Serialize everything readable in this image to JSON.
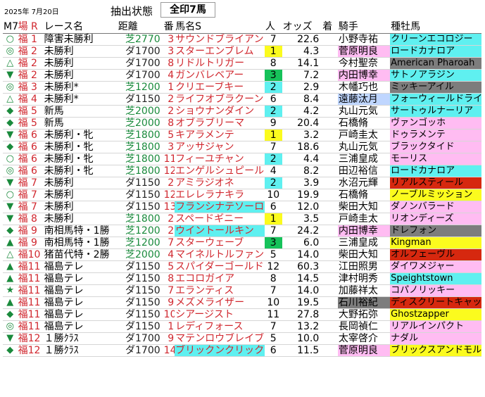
{
  "header": {
    "date": "2025年 7月20日",
    "state_label": "抽出状態",
    "state_value": "全印7馬"
  },
  "columns": [
    "M7",
    "場 R",
    "レース名",
    "距離",
    "番",
    "馬名S",
    "人",
    "オッズ",
    "着",
    "騎手",
    "種牡馬"
  ],
  "colors": {
    "cyan": "#5ff0f0",
    "yellow": "#fbfb1e",
    "green": "#16c25a",
    "pink": "#ffbcf2",
    "lightblue": "#bfd6ff",
    "gray": "#7d7d7d",
    "red": "#d6280f",
    "turf": "#1a8a3c",
    "place": "#d0272e"
  },
  "rows": [
    {
      "mark": "○",
      "place": "福 1",
      "race": "障害未勝利",
      "dist": "芝2770",
      "surf": "turf",
      "num": "3",
      "horse": "サウンドブライアン",
      "horse_hl": "",
      "pop": "7",
      "pop_hl": "",
      "odds": "22.6",
      "jockey": "小野寺祐",
      "jockey_hl": "",
      "sire": "クリーンエコロジー",
      "sire_hl": "cyan"
    },
    {
      "mark": "◎",
      "place": "福 2",
      "race": "未勝利",
      "dist": "ダ1700",
      "surf": "dirt",
      "num": "3",
      "horse": "スターエンブレム",
      "horse_hl": "",
      "pop": "1",
      "pop_hl": "yellow",
      "odds": "4.3",
      "jockey": "菅原明良",
      "jockey_hl": "pink",
      "sire": "ロードカナロア",
      "sire_hl": "cyan"
    },
    {
      "mark": "△",
      "place": "福 2",
      "race": "未勝利",
      "dist": "ダ1700",
      "surf": "dirt",
      "num": "8",
      "horse": "リドルトリガー",
      "horse_hl": "",
      "pop": "8",
      "pop_hl": "",
      "odds": "14.1",
      "jockey": "今村聖奈",
      "jockey_hl": "",
      "sire": "American Pharoah",
      "sire_hl": "gray"
    },
    {
      "mark": "▼",
      "place": "福 2",
      "race": "未勝利",
      "dist": "ダ1700",
      "surf": "dirt",
      "num": "4",
      "horse": "ガンバレベアー",
      "horse_hl": "",
      "pop": "3",
      "pop_hl": "green",
      "odds": "7.2",
      "jockey": "内田博幸",
      "jockey_hl": "pink",
      "sire": "サトノアラジン",
      "sire_hl": "cyan"
    },
    {
      "mark": "◎",
      "place": "福 3",
      "race": "未勝利*",
      "dist": "芝1200",
      "surf": "turf",
      "num": "1",
      "horse": "クリエーブキー",
      "horse_hl": "",
      "pop": "2",
      "pop_hl": "cyan",
      "odds": "2.9",
      "jockey": "木幡巧也",
      "jockey_hl": "",
      "sire": "ミッキーアイル",
      "sire_hl": "gray"
    },
    {
      "mark": "△",
      "place": "福 4",
      "race": "未勝利*",
      "dist": "ダ1150",
      "surf": "dirt",
      "num": "2",
      "horse": "ライフオブラクーン",
      "horse_hl": "",
      "pop": "6",
      "pop_hl": "",
      "odds": "8.4",
      "jockey": "遠藤汰月",
      "jockey_hl": "lightblue",
      "sire": "フォーウィールドライブ",
      "sire_hl": "cyan"
    },
    {
      "mark": "◆",
      "place": "福 5",
      "race": "新馬",
      "dist": "芝2000",
      "surf": "turf",
      "num": "2",
      "horse": "ショウナンダイン",
      "horse_hl": "",
      "pop": "2",
      "pop_hl": "cyan",
      "odds": "4.2",
      "jockey": "丸山元気",
      "jockey_hl": "",
      "sire": "サートゥルナーリア",
      "sire_hl": "cyan"
    },
    {
      "mark": "◆",
      "place": "福 5",
      "race": "新馬",
      "dist": "芝2000",
      "surf": "turf",
      "num": "8",
      "horse": "オブラブリーマ",
      "horse_hl": "",
      "pop": "9",
      "pop_hl": "",
      "odds": "20.4",
      "jockey": "石橋脩",
      "jockey_hl": "",
      "sire": "ヴァンゴッホ",
      "sire_hl": "pink"
    },
    {
      "mark": "▼",
      "place": "福 6",
      "race": "未勝利・牝",
      "dist": "芝1800",
      "surf": "turf",
      "num": "5",
      "horse": "キアラメンテ",
      "horse_hl": "",
      "pop": "1",
      "pop_hl": "yellow",
      "odds": "3.2",
      "jockey": "戸崎圭太",
      "jockey_hl": "",
      "sire": "ドゥラメンテ",
      "sire_hl": "pink"
    },
    {
      "mark": "◆",
      "place": "福 6",
      "race": "未勝利・牝",
      "dist": "芝1800",
      "surf": "turf",
      "num": "3",
      "horse": "アッサジャン",
      "horse_hl": "",
      "pop": "7",
      "pop_hl": "",
      "odds": "18.6",
      "jockey": "丸山元気",
      "jockey_hl": "",
      "sire": "ブラックタイド",
      "sire_hl": "pink"
    },
    {
      "mark": "○",
      "place": "福 6",
      "race": "未勝利・牝",
      "dist": "芝1800",
      "surf": "turf",
      "num": "11",
      "horse": "フィーユチャン",
      "horse_hl": "",
      "pop": "2",
      "pop_hl": "cyan",
      "odds": "4.4",
      "jockey": "三浦皇成",
      "jockey_hl": "",
      "sire": "モーリス",
      "sire_hl": "pink"
    },
    {
      "mark": "◎",
      "place": "福 6",
      "race": "未勝利・牝",
      "dist": "芝1800",
      "surf": "turf",
      "num": "12",
      "horse": "エンゲルシュピール",
      "horse_hl": "",
      "pop": "4",
      "pop_hl": "",
      "odds": "8.2",
      "jockey": "田辺裕信",
      "jockey_hl": "",
      "sire": "ロードカナロア",
      "sire_hl": "cyan"
    },
    {
      "mark": "▼",
      "place": "福 7",
      "race": "未勝利",
      "dist": "ダ1150",
      "surf": "dirt",
      "num": "2",
      "horse": "アミラジオネ",
      "horse_hl": "",
      "pop": "2",
      "pop_hl": "cyan",
      "odds": "3.9",
      "jockey": "水沼元輝",
      "jockey_hl": "",
      "sire": "リアルスティール",
      "sire_hl": "red"
    },
    {
      "mark": "○",
      "place": "福 7",
      "race": "未勝利",
      "dist": "ダ1150",
      "surf": "dirt",
      "num": "12",
      "horse": "エレレラナキラ",
      "horse_hl": "",
      "pop": "10",
      "pop_hl": "",
      "odds": "19.9",
      "jockey": "石橋脩",
      "jockey_hl": "",
      "sire": "ノーブルミッション",
      "sire_hl": "yellow"
    },
    {
      "mark": "▼",
      "place": "福 7",
      "race": "未勝利",
      "dist": "ダ1150",
      "surf": "dirt",
      "num": "13",
      "horse": "フランシナテソーロ",
      "horse_hl": "cyan",
      "pop": "6",
      "pop_hl": "",
      "odds": "12.0",
      "jockey": "柴田大知",
      "jockey_hl": "",
      "sire": "ダノンバラード",
      "sire_hl": "pink"
    },
    {
      "mark": "▼",
      "place": "福 8",
      "race": "未勝利",
      "dist": "芝1800",
      "surf": "turf",
      "num": "2",
      "horse": "スペードギニー",
      "horse_hl": "",
      "pop": "1",
      "pop_hl": "yellow",
      "odds": "3.5",
      "jockey": "戸崎圭太",
      "jockey_hl": "",
      "sire": "リオンディーズ",
      "sire_hl": "pink"
    },
    {
      "mark": "◆",
      "place": "福 9",
      "race": "南相馬特・1勝",
      "dist": "芝1200",
      "surf": "turf",
      "num": "2",
      "horse": "ウイントールキン",
      "horse_hl": "cyan",
      "pop": "7",
      "pop_hl": "",
      "odds": "24.2",
      "jockey": "内田博幸",
      "jockey_hl": "pink",
      "sire": "ドレフォン",
      "sire_hl": "gray"
    },
    {
      "mark": "▲",
      "place": "福 9",
      "race": "南相馬特・1勝",
      "dist": "芝1200",
      "surf": "turf",
      "num": "7",
      "horse": "スターウェーブ",
      "horse_hl": "",
      "pop": "3",
      "pop_hl": "green",
      "odds": "6.0",
      "jockey": "三浦皇成",
      "jockey_hl": "",
      "sire": "Kingman",
      "sire_hl": "yellow"
    },
    {
      "mark": "△",
      "place": "福10",
      "race": "猪苗代特・2勝",
      "dist": "芝2000",
      "surf": "turf",
      "num": "4",
      "horse": "マイネルトルファン",
      "horse_hl": "",
      "pop": "5",
      "pop_hl": "",
      "odds": "14.0",
      "jockey": "柴田大知",
      "jockey_hl": "",
      "sire": "オルフェーヴル",
      "sire_hl": "red"
    },
    {
      "mark": "▲",
      "place": "福11",
      "race": "福島テレ",
      "dist": "ダ1150",
      "surf": "dirt",
      "num": "5",
      "horse": "スパイダーゴールド",
      "horse_hl": "",
      "pop": "12",
      "pop_hl": "",
      "odds": "60.3",
      "jockey": "江田照男",
      "jockey_hl": "",
      "sire": "ダイワメジャー",
      "sire_hl": "pink"
    },
    {
      "mark": "▲",
      "place": "福11",
      "race": "福島テレ",
      "dist": "ダ1150",
      "surf": "dirt",
      "num": "8",
      "horse": "エコロガイア",
      "horse_hl": "",
      "pop": "8",
      "pop_hl": "",
      "odds": "14.5",
      "jockey": "津村明秀",
      "jockey_hl": "",
      "sire": "Speightstown",
      "sire_hl": "cyan"
    },
    {
      "mark": "★",
      "place": "福11",
      "race": "福島テレ",
      "dist": "ダ1150",
      "surf": "dirt",
      "num": "7",
      "horse": "エランティス",
      "horse_hl": "",
      "pop": "7",
      "pop_hl": "",
      "odds": "14.0",
      "jockey": "加藤祥太",
      "jockey_hl": "",
      "sire": "コパノリッキー",
      "sire_hl": "pink"
    },
    {
      "mark": "▲",
      "place": "福11",
      "race": "福島テレ",
      "dist": "ダ1150",
      "surf": "dirt",
      "num": "9",
      "horse": "メズメライザー",
      "horse_hl": "",
      "pop": "10",
      "pop_hl": "",
      "odds": "19.5",
      "jockey": "石川裕紀",
      "jockey_hl": "gray",
      "sire": "ディスクリートキャット",
      "sire_hl": "red"
    },
    {
      "mark": "◆",
      "place": "福11",
      "race": "福島テレ",
      "dist": "ダ1150",
      "surf": "dirt",
      "num": "10",
      "horse": "シアージスト",
      "horse_hl": "",
      "pop": "11",
      "pop_hl": "",
      "odds": "27.8",
      "jockey": "大野拓弥",
      "jockey_hl": "",
      "sire": "Ghostzapper",
      "sire_hl": "yellow"
    },
    {
      "mark": "◎",
      "place": "福11",
      "race": "福島テレ",
      "dist": "ダ1150",
      "surf": "dirt",
      "num": "1",
      "horse": "レディフォース",
      "horse_hl": "",
      "pop": "7",
      "pop_hl": "",
      "odds": "13.2",
      "jockey": "長岡禎仁",
      "jockey_hl": "",
      "sire": "リアルインパクト",
      "sire_hl": "pink"
    },
    {
      "mark": "▼",
      "place": "福12",
      "race": "１勝ｸﾗｽ",
      "dist": "ダ1700",
      "surf": "dirt",
      "num": "9",
      "horse": "マテンロウブレイブ",
      "horse_hl": "",
      "pop": "5",
      "pop_hl": "",
      "odds": "10.0",
      "jockey": "太宰啓介",
      "jockey_hl": "",
      "sire": "ナダル",
      "sire_hl": "pink"
    },
    {
      "mark": "◆",
      "place": "福12",
      "race": "１勝ｸﾗｽ",
      "dist": "ダ1700",
      "surf": "dirt",
      "num": "14",
      "horse": "ブリックンクリック",
      "horse_hl": "cyan",
      "pop": "6",
      "pop_hl": "",
      "odds": "11.5",
      "jockey": "菅原明良",
      "jockey_hl": "pink",
      "sire": "ブリックスアンドモルタル",
      "sire_hl": "yellow"
    }
  ]
}
